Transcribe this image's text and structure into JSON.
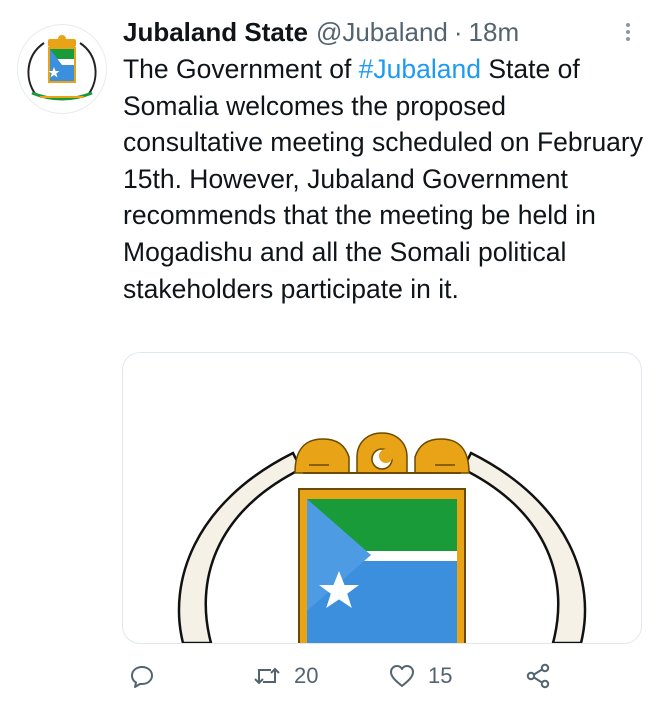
{
  "tweet": {
    "display_name": "Jubaland State",
    "handle": "@Jubaland",
    "separator": "·",
    "time": "18m",
    "text_before": "The Government of ",
    "hashtag": "#Jubaland",
    "text_after": " State of Somalia welcomes the proposed consultative meeting scheduled on February 15th. However, Jubaland Government recommends that the meeting be held in Mogadishu and all the Somali political stakeholders participate in it.",
    "avatar_icon": "jubaland-emblem-icon",
    "media_icon": "jubaland-emblem-icon"
  },
  "actions": {
    "reply_icon": "reply-icon",
    "retweet_icon": "retweet-icon",
    "retweet_count": "20",
    "like_icon": "heart-icon",
    "like_count": "15",
    "share_icon": "share-icon"
  },
  "colors": {
    "text": "#0f1419",
    "secondary": "#536471",
    "link": "#1d9bf0",
    "emblem_gold": "#e8a317",
    "emblem_green": "#1a9b3a",
    "emblem_blue": "#3b8fdc"
  }
}
